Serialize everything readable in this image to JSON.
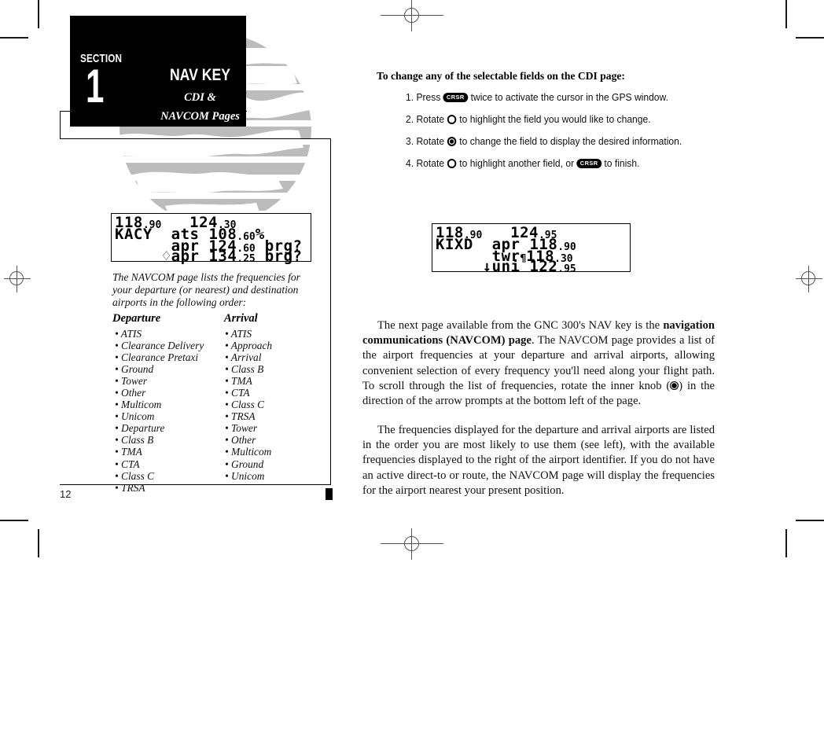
{
  "document": {
    "page_number": "12",
    "section": {
      "label": "SECTION",
      "number": "1",
      "title": "NAV KEY",
      "subtitle_line1": "CDI &",
      "subtitle_line2": "NAVCOM Pages"
    }
  },
  "left_column": {
    "lcd_cdi": {
      "line1_left_int": "118",
      "line1_left_dec": "90",
      "line1_right_int": "124",
      "line1_right_dec": "30",
      "line2_ident": "KACY",
      "line2_type": "ats",
      "line2_freq_int": "108",
      "line2_freq_dec": "60",
      "line2_suffix": "%",
      "line3_type": "apr",
      "line3_freq_int": "124",
      "line3_freq_dec": "60",
      "line3_suffix": "brg?",
      "line4_arrow": "♢",
      "line4_type": "apr",
      "line4_freq_int": "134",
      "line4_freq_dec": "25",
      "line4_suffix": "brg?"
    },
    "caption": "The NAVCOM page lists the frequencies for your departure (or nearest) and destination airports in the following order:",
    "departure": {
      "heading": "Departure",
      "items": [
        "ATIS",
        "Clearance Delivery",
        "Clearance Pretaxi",
        "Ground",
        "Tower",
        "Other",
        "Multicom",
        "Unicom",
        "Departure",
        "Class B",
        "TMA",
        "CTA",
        "Class C",
        "TRSA"
      ]
    },
    "arrival": {
      "heading": "Arrival",
      "items": [
        "ATIS",
        "Approach",
        "Arrival",
        "Class B",
        "TMA",
        "CTA",
        "Class C",
        "TRSA",
        "Tower",
        "Other",
        "Multicom",
        "Ground",
        "Unicom"
      ]
    }
  },
  "right_column": {
    "procedure_heading": "To change any of the selectable fields on the CDI page:",
    "steps": [
      {
        "num": "1.",
        "pre": "Press",
        "button": "CRSR",
        "post": "twice to activate the cursor in the GPS window.",
        "knob": null
      },
      {
        "num": "2.",
        "pre": "Rotate",
        "button": null,
        "post": "to highlight the field you would like to change.",
        "knob": "outer"
      },
      {
        "num": "3.",
        "pre": "Rotate",
        "button": null,
        "post": "to change the field to display the desired information.",
        "knob": "inner"
      },
      {
        "num": "4.",
        "pre": "Rotate",
        "button": null,
        "post_a": "to highlight another field, or",
        "button2": "CRSR",
        "post_b": "to finish.",
        "knob": "outer"
      }
    ],
    "lcd_navcom": {
      "line1_left_int": "118",
      "line1_left_dec": "90",
      "line1_right_int": "124",
      "line1_right_dec": "95",
      "line2_ident": "KIXD",
      "line2_type": "apr",
      "line2_freq_int": "118",
      "line2_freq_dec": "90",
      "line3_type": "twr",
      "line3_marker": "¶",
      "line3_freq_int": "118",
      "line3_freq_dec": "30",
      "line4_arrow": "↓",
      "line4_type": "uni",
      "line4_freq_int": "122",
      "line4_freq_dec": "95"
    },
    "paragraph1_a": "The next page available from the GNC 300's NAV key is the ",
    "paragraph1_bold": "navigation communications (NAVCOM) page",
    "paragraph1_b": ". The NAVCOM page provides a list of the airport frequencies at your departure and arrival airports, allowing convenient selection of every frequency you'll need along your flight path. To scroll through the list of frequencies, rotate the inner knob (",
    "paragraph1_c": ") in the direction of the arrow prompts at the bottom left of the page.",
    "paragraph2": "The frequencies displayed for the departure and arrival airports are listed in the order you are most likely to use them (see left), with the available frequencies displayed to the right of the airport identifier. If you do not have an active direct-to or route, the NAVCOM page will display the frequencies for the airport nearest your present position."
  },
  "colors": {
    "ink": "#000000",
    "paper": "#ffffff",
    "watermark": "#bcbcbc",
    "reg_mark": "#555555"
  }
}
